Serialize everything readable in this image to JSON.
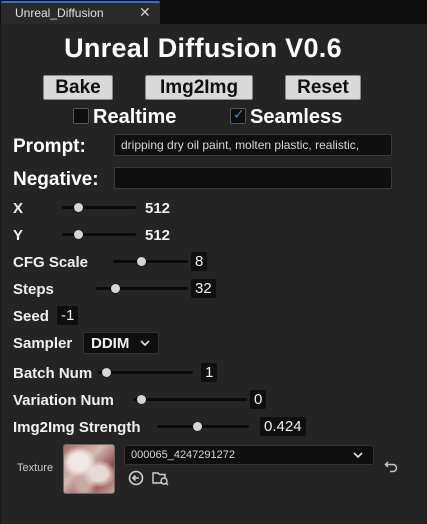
{
  "tab": {
    "title": "Unreal_Diffusion",
    "close_glyph": "✕"
  },
  "header": {
    "title": "Unreal Diffusion V0.6"
  },
  "buttons": {
    "bake": "Bake",
    "img2img": "Img2Img",
    "reset": "Reset"
  },
  "toggles": {
    "realtime": {
      "label": "Realtime",
      "checked": false
    },
    "seamless": {
      "label": "Seamless",
      "checked": true
    }
  },
  "prompt": {
    "label": "Prompt:",
    "value": "dripping dry oil paint, molten plastic, realistic,"
  },
  "negative": {
    "label": "Negative:",
    "value": ""
  },
  "params": {
    "x": {
      "label": "X",
      "value": "512",
      "level": 0.15
    },
    "y": {
      "label": "Y",
      "value": "512",
      "level": 0.15
    },
    "cfg_scale": {
      "label": "CFG Scale",
      "value": "8",
      "level": 0.35
    },
    "steps": {
      "label": "Steps",
      "value": "32",
      "level": 0.15
    },
    "seed": {
      "label": "Seed",
      "value": "-1"
    },
    "sampler": {
      "label": "Sampler",
      "value": "DDIM"
    },
    "batch_num": {
      "label": "Batch Num",
      "value": "1",
      "level": 0.0
    },
    "variation_num": {
      "label": "Variation Num",
      "value": "0",
      "level": 0.0
    },
    "img2img_strength": {
      "label": "Img2Img Strength",
      "value": "0.424",
      "level": 0.424
    }
  },
  "texture": {
    "label": "Texture",
    "asset_name": "000065_4247291272"
  },
  "colors": {
    "accent": "#2f6fd0",
    "check": "#3a86e0",
    "panel": "#242424"
  }
}
